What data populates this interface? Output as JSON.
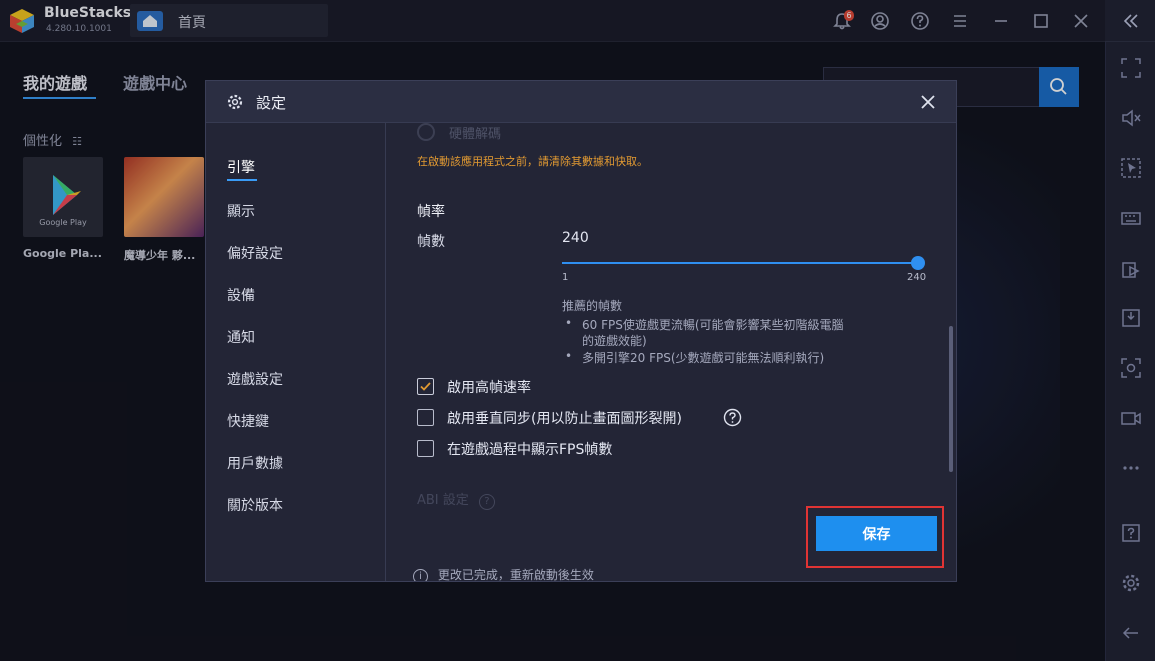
{
  "titlebar": {
    "app_name": "BlueStacks",
    "version": "4.280.10.1001",
    "home_tab_label": "首頁",
    "notification_count": "6"
  },
  "home": {
    "tabs": [
      "我的遊戲",
      "遊戲中心"
    ],
    "personalize": "個性化",
    "apps": [
      {
        "label": "Google Pla...",
        "icon_caption": "Google Play"
      },
      {
        "label": "魔導少年 夥..."
      }
    ]
  },
  "settings": {
    "title": "設定",
    "nav": [
      "引擎",
      "顯示",
      "偏好設定",
      "設備",
      "通知",
      "遊戲設定",
      "快捷鍵",
      "用戶數據",
      "關於版本"
    ],
    "active_nav_index": 0,
    "faded_option": "硬體解碼",
    "warning": "在啟動該應用程式之前，請清除其數據和快取。",
    "fps": {
      "section_title": "幀率",
      "label": "幀數",
      "value": "240",
      "min": "1",
      "max": "240",
      "slider_fraction": 1.0,
      "recommended_title": "推薦的幀數",
      "recommended": [
        "60 FPS使遊戲更流暢(可能會影響某些初階級電腦",
        "的遊戲效能)",
        "多開引擎20 FPS(少數遊戲可能無法順利執行)"
      ]
    },
    "checkboxes": [
      {
        "label": "啟用高幀速率",
        "checked": true
      },
      {
        "label": "啟用垂直同步(用以防止畫面圖形裂開)",
        "checked": false,
        "help": true
      },
      {
        "label": "在遊戲過程中顯示FPS幀數",
        "checked": false
      }
    ],
    "abi_label": "ABI 設定",
    "footer_info": "更改已完成，重新啟動後生效",
    "save_label": "保存"
  },
  "colors": {
    "accent": "#1e8fef",
    "warning": "#e29a32",
    "highlight": "#e03434"
  }
}
